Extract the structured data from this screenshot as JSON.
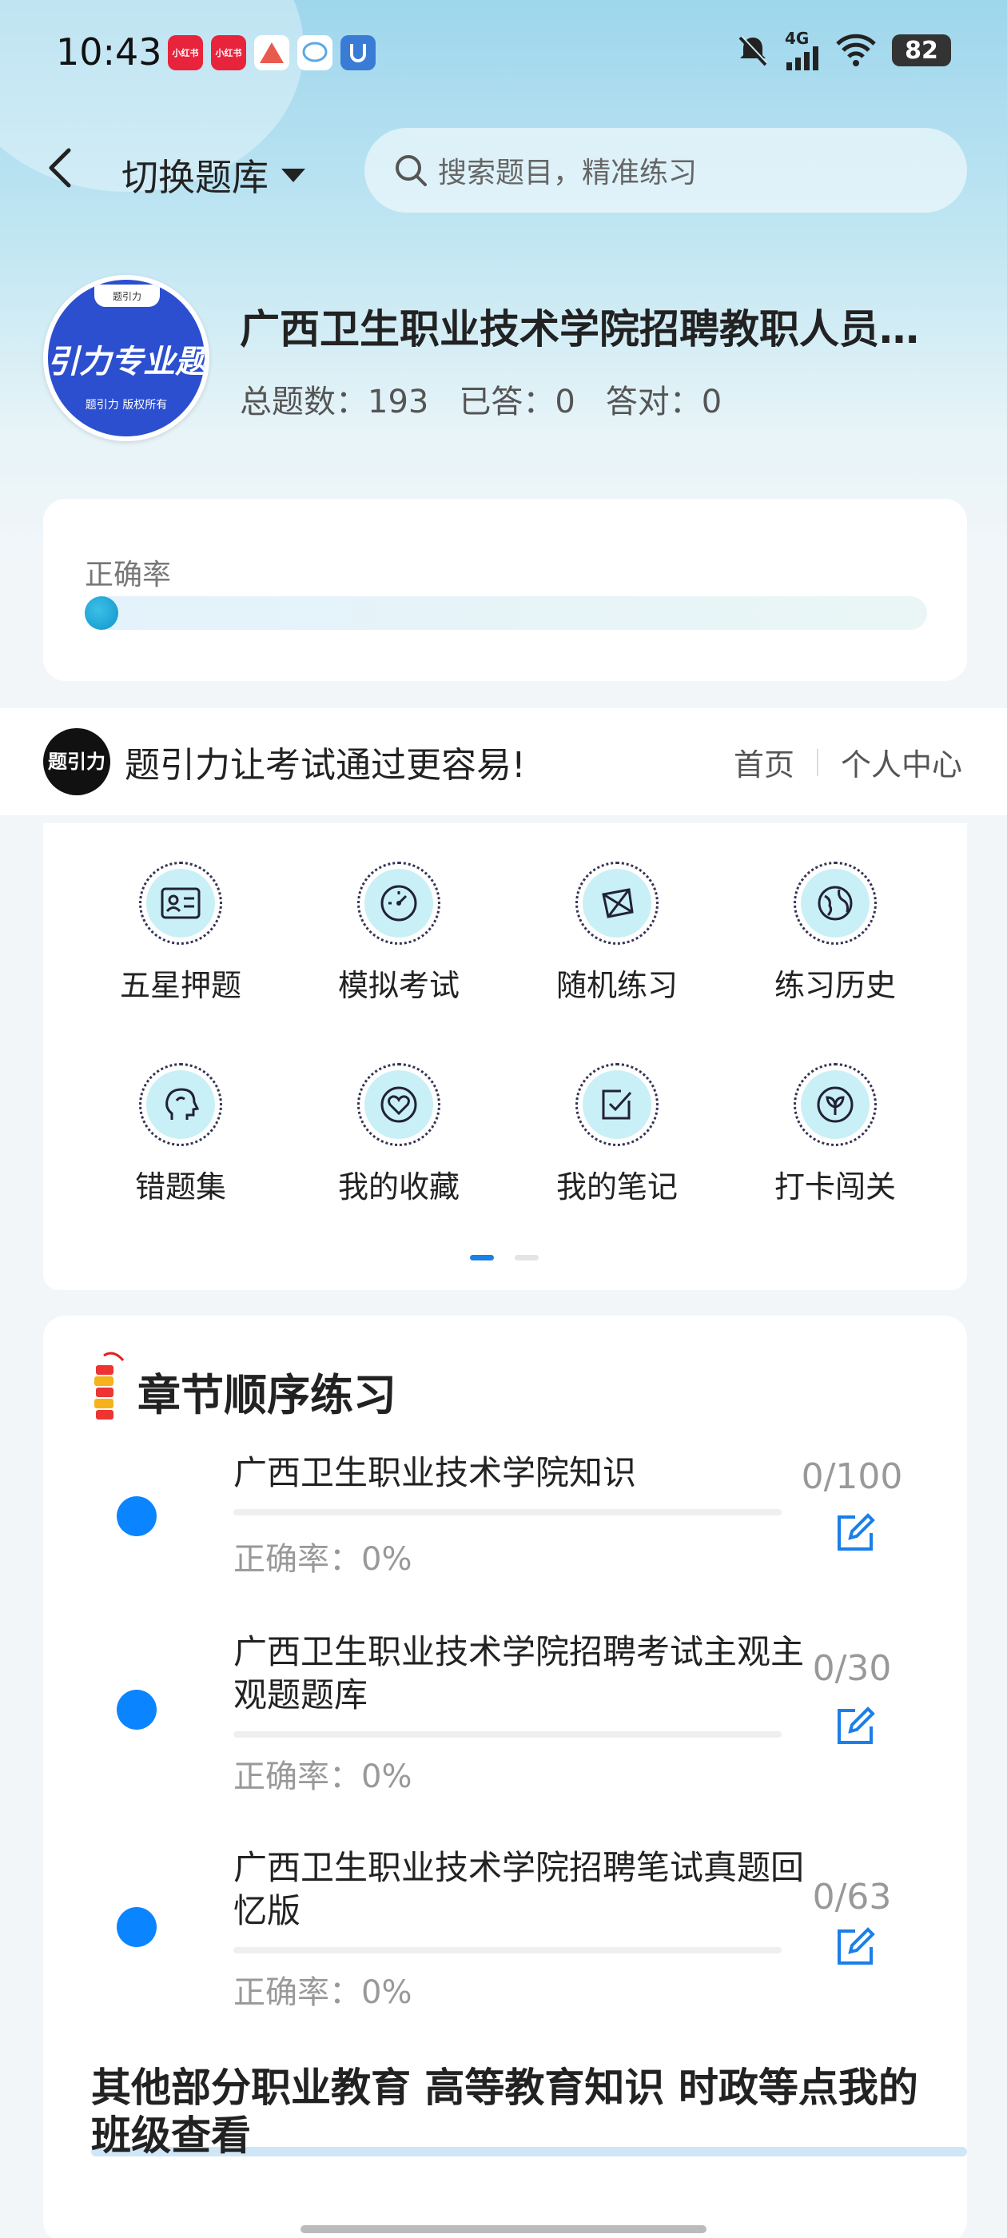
{
  "status_bar": {
    "time": "10:43",
    "apps": [
      {
        "icon": "xiaohongshu-icon",
        "label": "小红书",
        "color": "#e8243c"
      },
      {
        "icon": "xiaohongshu-icon",
        "label": "小红书",
        "color": "#e8243c"
      },
      {
        "icon": "app-a-icon",
        "label": "",
        "color": "#e85a4f"
      },
      {
        "icon": "chat-icon",
        "label": "",
        "color": "#5aa9e6"
      },
      {
        "icon": "app-u-icon",
        "label": "",
        "color": "#3a7bd5"
      }
    ],
    "network": "4G",
    "battery": "82"
  },
  "nav": {
    "switch_label": "切换题库",
    "search_placeholder": "搜索题目，精准练习"
  },
  "bank": {
    "logo_tab": "题引力",
    "logo_text": "引力专业题",
    "logo_sub": "题引力 版权所有",
    "title": "广西卫生职业技术学院招聘教职人员…",
    "total_label": "总题数：193",
    "answered_label": "已答：0",
    "correct_label": "答对：0"
  },
  "accuracy": {
    "label": "正确率",
    "value": 0
  },
  "banner": {
    "logo_text": "题引力",
    "slogan": "题引力让考试通过更容易!",
    "link_home": "首页",
    "link_profile": "个人中心"
  },
  "functions": [
    {
      "label": "五星押题",
      "icon": "id-card-icon"
    },
    {
      "label": "模拟考试",
      "icon": "gauge-icon"
    },
    {
      "label": "随机练习",
      "icon": "shuffle-network-icon"
    },
    {
      "label": "练习历史",
      "icon": "globe-icon"
    },
    {
      "label": "错题集",
      "icon": "head-icon"
    },
    {
      "label": "我的收藏",
      "icon": "heart-icon"
    },
    {
      "label": "我的笔记",
      "icon": "check-note-icon"
    },
    {
      "label": "打卡闯关",
      "icon": "leaf-badge-icon"
    }
  ],
  "pager": {
    "active": 0,
    "total": 2
  },
  "chapters": {
    "title": "章节顺序练习",
    "items": [
      {
        "name": "广西卫生职业技术学院知识",
        "accuracy": "正确率：0%",
        "count": "0/100"
      },
      {
        "name": "广西卫生职业技术学院招聘考试主观主观题题库",
        "accuracy": "正确率：0%",
        "count": "0/30"
      },
      {
        "name": "广西卫生职业技术学院招聘笔试真题回忆版",
        "accuracy": "正确率：0%",
        "count": "0/63"
      }
    ],
    "other": "其他部分职业教育 高等教育知识 时政等点我的班级查看"
  },
  "colors": {
    "accent_blue": "#0b84ff",
    "header_top": "#9ed6ec",
    "icon_fill": "#c9f0f6"
  }
}
